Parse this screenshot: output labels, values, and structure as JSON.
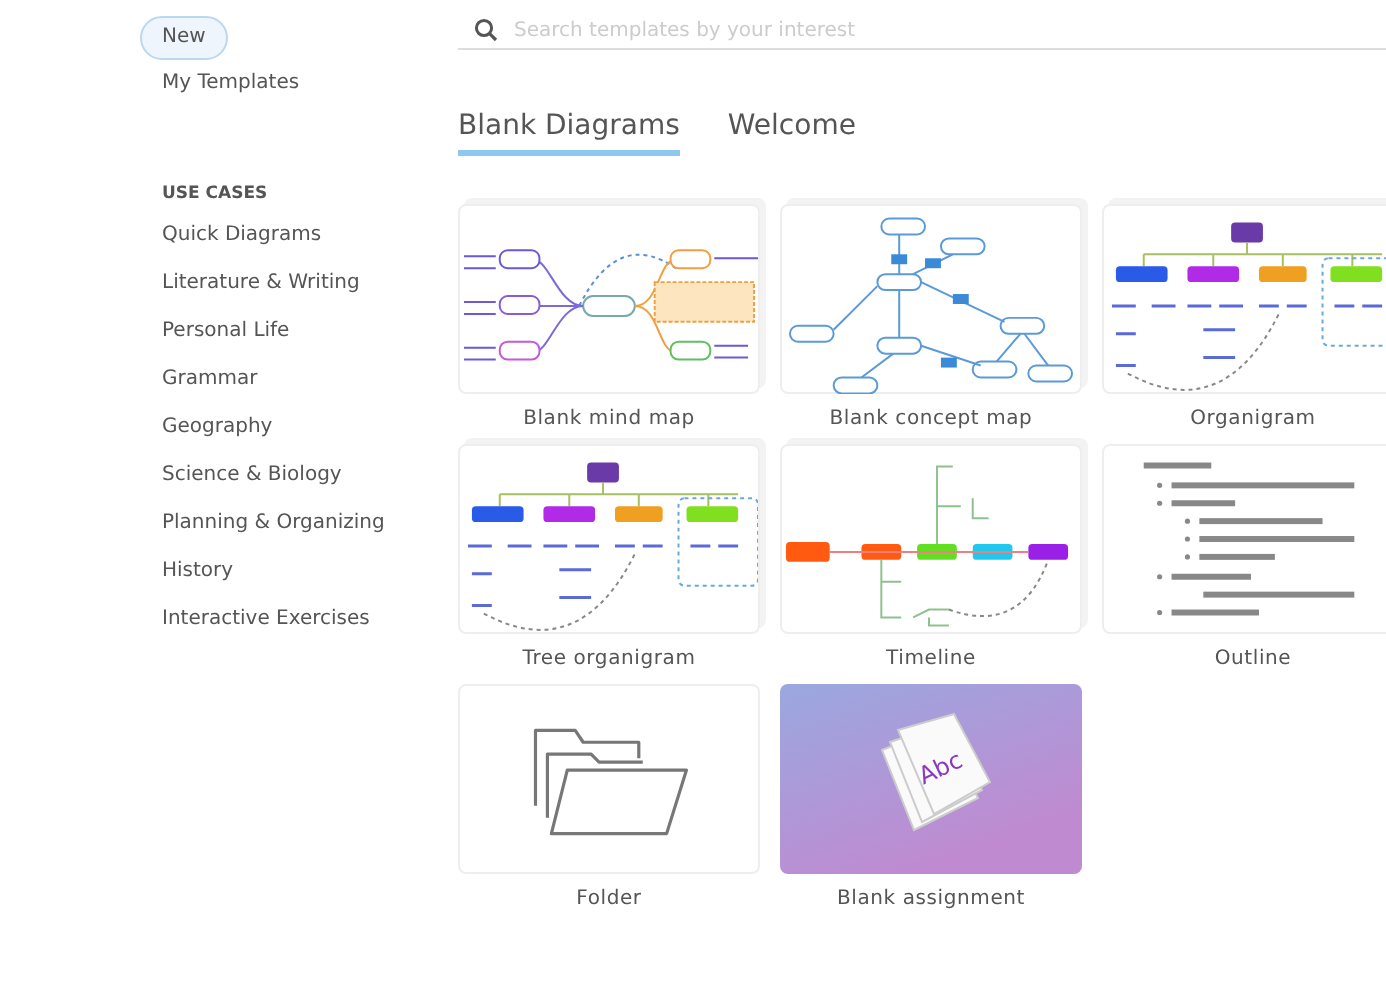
{
  "sidebar": {
    "items": [
      {
        "label": "New",
        "selected": true
      },
      {
        "label": "My Templates",
        "selected": false
      }
    ],
    "section_title": "USE CASES",
    "use_cases": [
      {
        "label": "Quick Diagrams",
        "selected": false
      },
      {
        "label": "Literature & Writing",
        "selected": false
      },
      {
        "label": "Personal Life",
        "selected": false
      },
      {
        "label": "Grammar",
        "selected": false
      },
      {
        "label": "Geography",
        "selected": false
      },
      {
        "label": "Science & Biology",
        "selected": false
      },
      {
        "label": "Planning & Organizing",
        "selected": false
      },
      {
        "label": "History",
        "selected": false
      },
      {
        "label": "Interactive Exercises",
        "selected": false
      }
    ]
  },
  "search": {
    "placeholder": "Search templates by your interest"
  },
  "tabs": [
    {
      "label": "Blank Diagrams",
      "selected": true
    },
    {
      "label": "Welcome",
      "selected": false
    }
  ],
  "templates": [
    {
      "title": "Blank mind map",
      "kind": "mindmap",
      "stacked": true
    },
    {
      "title": "Blank concept map",
      "kind": "concept",
      "stacked": true
    },
    {
      "title": "Organigram",
      "kind": "organigram",
      "stacked": true
    },
    {
      "title": "Tree organigram",
      "kind": "tree",
      "stacked": true
    },
    {
      "title": "Timeline",
      "kind": "timeline",
      "stacked": true
    },
    {
      "title": "Outline",
      "kind": "outline",
      "stacked": false
    },
    {
      "title": "Folder",
      "kind": "folder",
      "stacked": false
    },
    {
      "title": "Blank assignment",
      "kind": "assignment",
      "stacked": false,
      "art_text": "Abc"
    }
  ]
}
